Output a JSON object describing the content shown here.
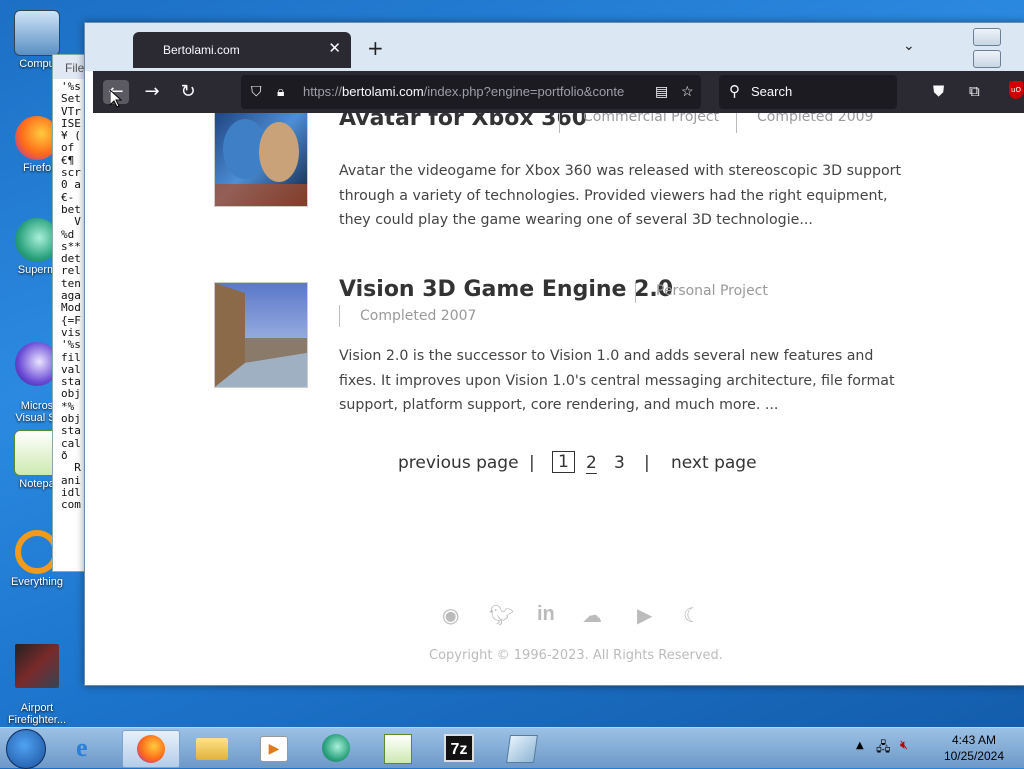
{
  "desktop": {
    "icons": [
      {
        "label": "Compu"
      },
      {
        "label": "Firefo"
      },
      {
        "label": "Superm"
      },
      {
        "label": "Micros\nVisual St"
      },
      {
        "label": "Notepa"
      },
      {
        "label": "Everything"
      },
      {
        "label": "Airport\nFirefighter..."
      }
    ]
  },
  "notepad": {
    "menu": "File",
    "lines": [
      "'%s",
      "Set",
      "VTr",
      "ISE",
      "¥ (",
      "of",
      "€¶",
      "scr",
      "0 a",
      "€-",
      "bet",
      "  V",
      "%d",
      "s**",
      "det",
      "rel",
      "ten",
      "aga",
      "Mod",
      "{=F",
      "vis",
      "'%s",
      "fil",
      "val",
      "sta",
      "obj",
      "*%",
      "obj",
      "sta",
      "cal",
      "ð",
      "  R",
      "ani",
      "idl",
      "com"
    ]
  },
  "browser": {
    "tab_title": "Bertolami.com",
    "url_prefix": "https://",
    "url_host": "bertolami.com",
    "url_path": "/index.php?engine=portfolio&conte",
    "search_placeholder": "Search"
  },
  "page": {
    "projects": [
      {
        "title": "Avatar for Xbox 360",
        "category": "Commercial Project",
        "completed": "Completed 2009",
        "description": "Avatar the videogame for Xbox 360 was released with stereoscopic 3D support through a variety of technologies. Provided viewers had the right equipment, they could play the game wearing one of several 3D technologie..."
      },
      {
        "title": "Vision 3D Game Engine 2.0",
        "category": "Personal Project",
        "completed": "Completed 2007",
        "description": "Vision 2.0 is the successor to Vision 1.0 and adds several new features and fixes. It improves upon Vision 1.0's central messaging architecture, file format support, platform support, core rendering, and much more. ..."
      }
    ],
    "pagination": {
      "previous": "previous page",
      "separator": "|",
      "pages": [
        "1",
        "2",
        "3"
      ],
      "next": "next page"
    },
    "footer": {
      "copyright": "Copyright © 1996-2023. All Rights Reserved."
    }
  },
  "taskbar": {
    "clock_time": "4:43 AM",
    "clock_date": "10/25/2024"
  }
}
